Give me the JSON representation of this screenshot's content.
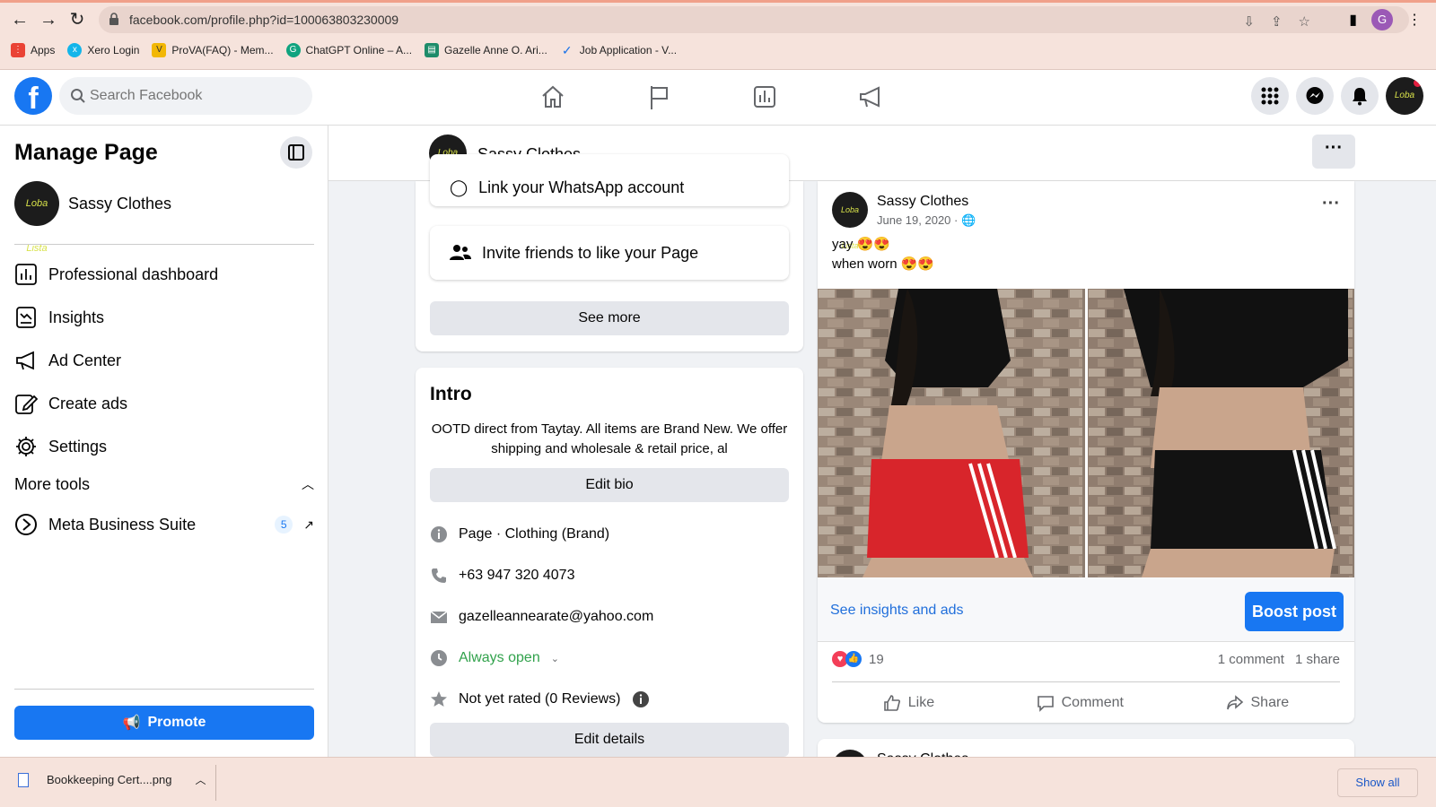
{
  "browser": {
    "url": "facebook.com/profile.php?id=100063803230009",
    "profile_initial": "G",
    "bookmarks": [
      {
        "label": "Apps",
        "icon": "apps-grid-icon"
      },
      {
        "label": "Xero Login",
        "icon": "xero-icon"
      },
      {
        "label": "ProVA(FAQ) - Mem...",
        "icon": "prova-icon"
      },
      {
        "label": "ChatGPT Online – A...",
        "icon": "chatgpt-icon"
      },
      {
        "label": "Gazelle Anne O. Ari...",
        "icon": "resume-icon"
      },
      {
        "label": "Job Application - V...",
        "icon": "check-icon"
      }
    ]
  },
  "header": {
    "search_placeholder": "Search Facebook"
  },
  "sidebar": {
    "title": "Manage Page",
    "page_name": "Sassy Clothes",
    "avatar_text": "Loba Lista",
    "items": [
      {
        "label": "Professional dashboard",
        "icon": "dashboard-icon"
      },
      {
        "label": "Insights",
        "icon": "insights-icon"
      },
      {
        "label": "Ad Center",
        "icon": "megaphone-icon"
      },
      {
        "label": "Create ads",
        "icon": "pencil-icon"
      },
      {
        "label": "Settings",
        "icon": "gear-icon"
      }
    ],
    "more_tools_label": "More tools",
    "mbs_label": "Meta Business Suite",
    "mbs_badge": "5",
    "promote_label": "Promote"
  },
  "pagebar": {
    "name": "Sassy Clothes"
  },
  "middle": {
    "whatsapp_label": "Link your WhatsApp account",
    "invite_label": "Invite friends to like your Page",
    "see_more_label": "See more",
    "intro_title": "Intro",
    "bio": "OOTD direct from Taytay. All items are Brand New. We offer shipping and wholesale & retail price, al",
    "edit_bio_label": "Edit bio",
    "page_type_bold": "Page",
    "page_type_rest": " · Clothing (Brand)",
    "phone": "+63 947 320 4073",
    "email": "gazelleannearate@yahoo.com",
    "hours": "Always open",
    "rating": "Not yet rated (0 Reviews)",
    "edit_details_label": "Edit details"
  },
  "post": {
    "author": "Sassy Clothes",
    "date": "June 19, 2020 ·",
    "line1": "yay 😍😍",
    "line2": "when worn 😍😍",
    "insights_link": "See insights and ads",
    "boost_label": "Boost post",
    "reaction_count": "19",
    "comments": "1 comment",
    "shares": "1 share",
    "like_label": "Like",
    "comment_label": "Comment",
    "share_label": "Share",
    "next_author": "Sassy Clothes"
  },
  "downloads": {
    "file": "Bookkeeping Cert....png",
    "show_all": "Show all"
  },
  "colors": {
    "brand_blue": "#1877f2",
    "chrome_bg": "#f6e3dc",
    "open_green": "#31a24c"
  }
}
